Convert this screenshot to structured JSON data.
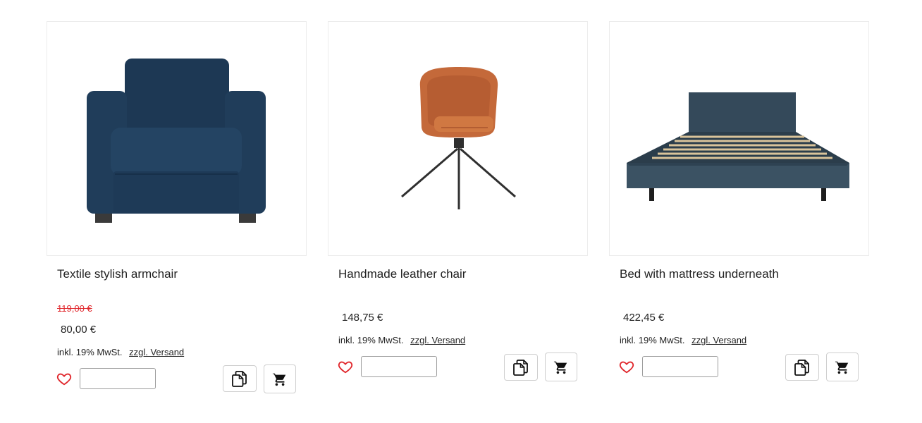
{
  "products": [
    {
      "title": "Textile stylish armchair",
      "old_price": "119,00 €",
      "price": "80,00 €",
      "tax_note": "inkl. 19% MwSt.",
      "shipping_link": "zzgl. Versand",
      "image_icon": "armchair-image"
    },
    {
      "title": "Handmade leather chair",
      "price": "148,75 €",
      "tax_note": "inkl. 19% MwSt.",
      "shipping_link": "zzgl. Versand",
      "image_icon": "leather-chair-image"
    },
    {
      "title": "Bed with mattress underneath",
      "price": "422,45 €",
      "tax_note": "inkl. 19% MwSt.",
      "shipping_link": "zzgl. Versand",
      "image_icon": "bed-image"
    }
  ],
  "icons": {
    "wishlist": "heart-icon",
    "compare": "compare-icon",
    "cart": "cart-icon"
  },
  "colors": {
    "sale_price": "#e0262b",
    "wishlist_heart": "#e0262b",
    "armchair_fabric": "#1f3a55",
    "leather": "#c4693a",
    "bed_fabric": "#34495a"
  }
}
